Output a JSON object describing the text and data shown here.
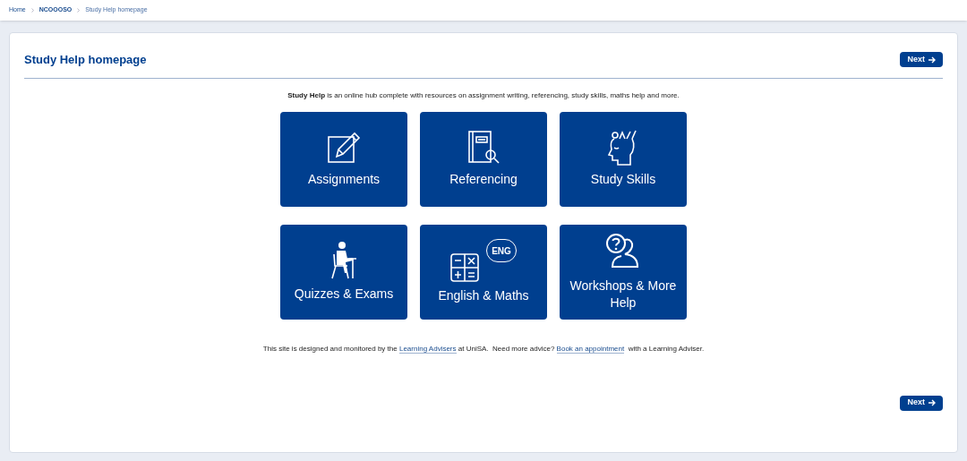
{
  "breadcrumbs": [
    {
      "label": "Home",
      "current": false,
      "bold": false
    },
    {
      "label": "NCOOOSO",
      "current": false,
      "bold": true
    },
    {
      "label": "Study Help homepage",
      "current": true,
      "bold": false
    }
  ],
  "page_title": "Study Help homepage",
  "next_buttons": [
    "Next",
    "Next"
  ],
  "intro": "**Study Help** is an online hub complete with resources on assignment writing, referencing, study skills, maths help and more.",
  "tiles": [
    {
      "label": "Assignments",
      "kind": "pencil"
    },
    {
      "label": "Referencing",
      "kind": "book"
    },
    {
      "label": "Study Skills",
      "kind": "head"
    },
    {
      "label": "Quizzes & Exams",
      "kind": "student"
    },
    {
      "label": "English & Maths",
      "kind": "calculator",
      "icon_text": "ENG"
    },
    {
      "label": "Workshops & More Help",
      "kind": "question"
    }
  ],
  "footer": [
    {
      "kind": "text",
      "text": "This site is designed and monitored by the "
    },
    {
      "kind": "link",
      "text": "Learning Advisers"
    },
    {
      "kind": "text",
      "text": " at UniSA.  Need more advice? "
    },
    {
      "kind": "link",
      "text": "Book an appointment"
    },
    {
      "kind": "text",
      "text": "  with a Learning Adviser."
    }
  ]
}
